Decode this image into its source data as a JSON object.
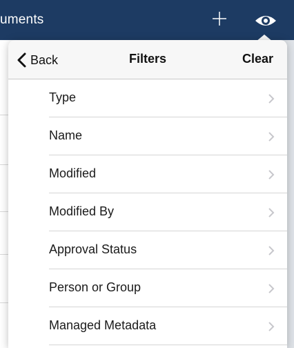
{
  "header": {
    "title": "uments",
    "add_icon": "plus-icon",
    "view_icon": "eye-icon"
  },
  "popover": {
    "back_label": "Back",
    "title": "Filters",
    "clear_label": "Clear",
    "items": [
      {
        "label": "Type"
      },
      {
        "label": "Name"
      },
      {
        "label": "Modified"
      },
      {
        "label": "Modified By"
      },
      {
        "label": "Approval Status"
      },
      {
        "label": "Person or Group"
      },
      {
        "label": "Managed Metadata"
      }
    ]
  },
  "colors": {
    "header_bg": "#1d3b63",
    "header_text": "#ffffff",
    "nav_bg": "#f7f7f7",
    "chevron": "#c7c7cc"
  }
}
